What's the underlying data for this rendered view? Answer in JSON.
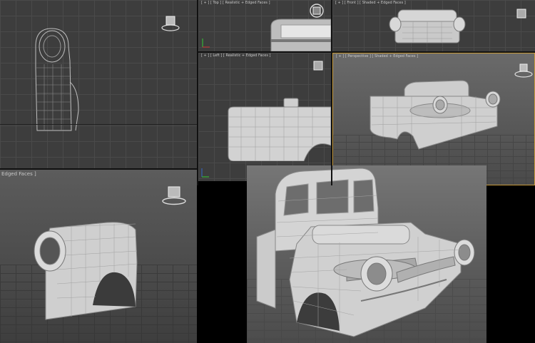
{
  "viewports": {
    "top_left": {
      "label": ""
    },
    "top_small": {
      "label": "[ + ] [ Top ] [ Realistic + Edged Faces ]"
    },
    "front": {
      "label": "[ + ] [ Front ] [ Shaded + Edged Faces ]"
    },
    "left": {
      "label": "[ + ] [ Left ] [ Realistic + Edged Faces ]"
    },
    "perspective": {
      "label": "[ + ] [ Perspective ] [ Shaded + Edged Faces ]"
    },
    "bottom_left": {
      "label": "Edged Faces ]"
    },
    "render": {
      "label": ""
    }
  },
  "icons": {
    "viewcube": "viewcube-icon",
    "steering_wheel": "steering-wheel-icon",
    "axis": "axis-gizmo-icon"
  },
  "colors": {
    "viewport_bg": "#3d3d3d",
    "grid_line": "#4a4a4a",
    "render_bg_top": "#6e6e6e",
    "model": "#cfcfcf",
    "wire": "#9a9a9a",
    "active_border": "#c89b3c"
  }
}
